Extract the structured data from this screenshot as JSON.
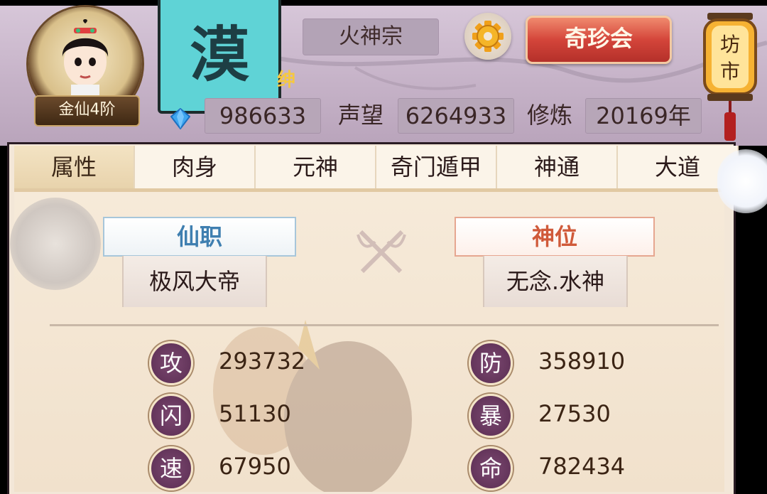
{
  "header": {
    "rank_label": "金仙4阶",
    "banner_char": "漠",
    "sect_name": "火神宗",
    "event_button": "奇珍会",
    "lantern_text_1": "坊",
    "lantern_text_2": "市",
    "gold_glyph": "绅",
    "currency_value": "986633",
    "reputation_label": "声望",
    "reputation_value": "6264933",
    "cultivation_label": "修炼",
    "cultivation_value": "20169年"
  },
  "tabs": [
    {
      "label": "属性",
      "active": true
    },
    {
      "label": "肉身",
      "active": false
    },
    {
      "label": "元神",
      "active": false
    },
    {
      "label": "奇门遁甲",
      "active": false
    },
    {
      "label": "神通",
      "active": false
    },
    {
      "label": "大道",
      "active": false
    }
  ],
  "titles": {
    "office_label": "仙职",
    "office_value": "极风大帝",
    "divine_label": "神位",
    "divine_value": "无念.水神"
  },
  "attributes": [
    {
      "icon": "攻",
      "value": "293732"
    },
    {
      "icon": "防",
      "value": "358910"
    },
    {
      "icon": "闪",
      "value": "51130"
    },
    {
      "icon": "暴",
      "value": "27530"
    },
    {
      "icon": "速",
      "value": "67950"
    },
    {
      "icon": "命",
      "value": "782434"
    }
  ],
  "colors": {
    "accent_red": "#d4453a",
    "banner_cyan": "#5fd3d6",
    "attr_icon_purple": "#5a2d52",
    "office_blue": "#3f7fb0",
    "divine_red": "#d05a3a"
  }
}
